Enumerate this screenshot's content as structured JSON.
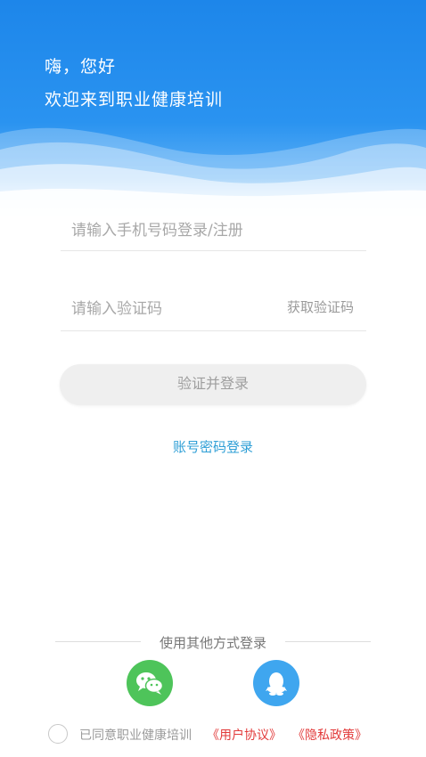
{
  "header": {
    "greeting": "嗨，您好",
    "welcome": "欢迎来到职业健康培训",
    "background_color": "#1d86ea"
  },
  "form": {
    "phone_placeholder": "请输入手机号码登录/注册",
    "code_placeholder": "请输入验证码",
    "get_code_label": "获取验证码",
    "submit_label": "验证并登录",
    "password_login_link": "账号密码登录"
  },
  "other_login": {
    "label": "使用其他方式登录",
    "options": [
      {
        "icon": "wechat-icon",
        "color": "#4ec45a"
      },
      {
        "icon": "qq-icon",
        "color": "#3fa6ef"
      }
    ]
  },
  "agreement": {
    "prefix": "已同意职业健康培训",
    "user_agreement": "《用户协议》",
    "privacy_policy": "《隐私政策》",
    "link_color": "#e23a3a"
  }
}
